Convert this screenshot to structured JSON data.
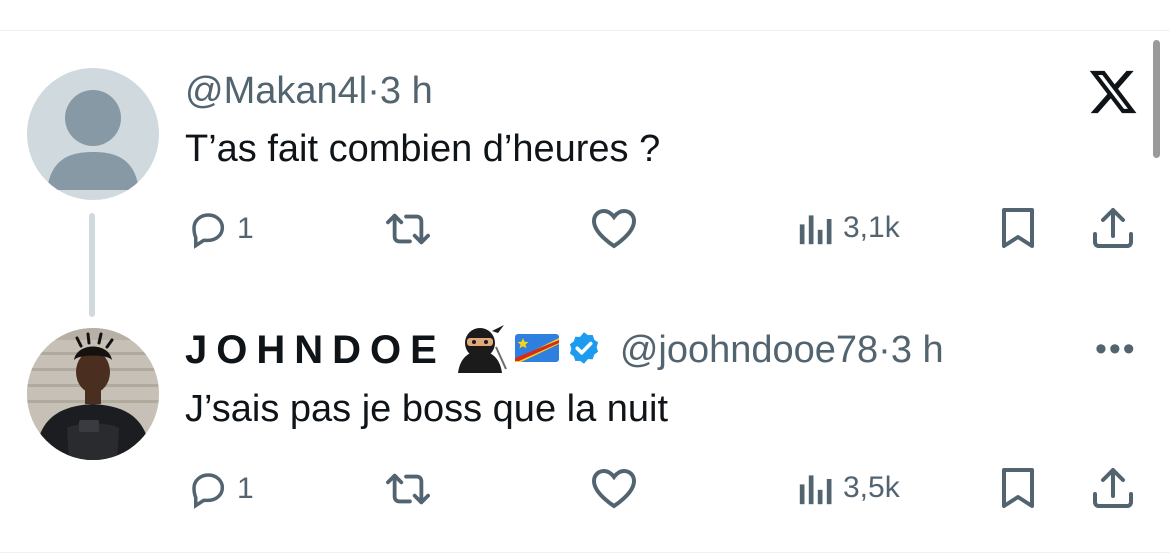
{
  "tweets": [
    {
      "handle": "@Makan4l",
      "separator": "·",
      "time": "3 h",
      "text": "T’as fait combien d’heures ?",
      "reply_count": "1",
      "views": "3,1k"
    },
    {
      "display_name": "JOHNDOE",
      "handle": "@joohndooe78",
      "separator": "·",
      "time": "3 h",
      "text": "J’sais pas je boss que la nuit",
      "reply_count": "1",
      "views": "3,5k",
      "name_icons": [
        "ninja-emoji",
        "drc-flag-emoji",
        "verified-badge"
      ]
    }
  ],
  "colors": {
    "text": "#0f1419",
    "secondary": "#536471",
    "verified": "#1d9bf0",
    "divider": "#eff3f4"
  }
}
